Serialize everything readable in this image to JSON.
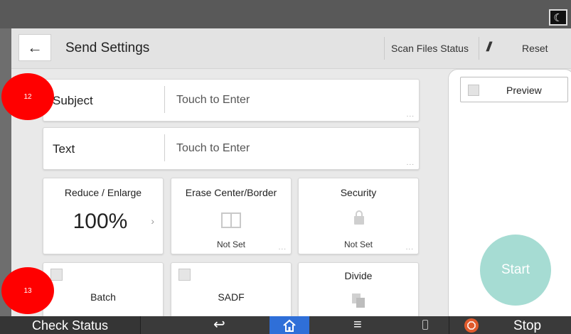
{
  "header": {
    "title": "Send Settings",
    "scan_files_status": "Scan Files Status",
    "reset": "Reset"
  },
  "fields": [
    {
      "label": "Subject",
      "value": "Touch to Enter",
      "more": "..."
    },
    {
      "label": "Text",
      "value": "Touch to Enter",
      "more": "..."
    }
  ],
  "tiles": {
    "reduce": {
      "title": "Reduce / Enlarge",
      "value": "100%"
    },
    "erase": {
      "title": "Erase Center/Border",
      "status": "Not Set",
      "more": "..."
    },
    "security": {
      "title": "Security",
      "status": "Not Set",
      "more": "..."
    },
    "batch": {
      "label": "Batch"
    },
    "sadf": {
      "label": "SADF"
    },
    "divide": {
      "title": "Divide"
    }
  },
  "right_panel": {
    "preview": "Preview",
    "start": "Start"
  },
  "bottom_bar": {
    "check_status": "Check Status",
    "stop": "Stop"
  },
  "badges": [
    "12",
    "13"
  ],
  "colors": {
    "start": "#a6dcd3",
    "home": "#2f6fd8",
    "stop": "#e05a2c",
    "badge": "#ff0000"
  },
  "icons": [
    "moon-icon",
    "back-arrow-icon",
    "slash-icon",
    "erase-frame-icon",
    "lock-icon",
    "divide-pages-icon",
    "return-icon",
    "home-icon",
    "menu-icon",
    "data-icon",
    "stop-icon"
  ]
}
